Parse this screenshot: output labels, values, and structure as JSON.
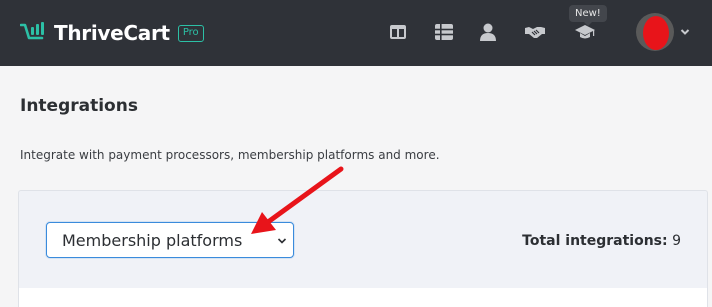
{
  "header": {
    "brand_left": "Thrive",
    "brand_right": "Cart",
    "plan_badge": "Pro",
    "new_tooltip": "New!",
    "icons": [
      "dashboard-icon",
      "list-icon",
      "user-icon",
      "handshake-icon",
      "graduation-cap-icon"
    ],
    "avatar": "user-avatar"
  },
  "page": {
    "title": "Integrations",
    "description": "Integrate with payment processors, membership platforms and more."
  },
  "filter": {
    "selected": "Membership platforms",
    "total_label": "Total integrations:",
    "total_value": "9"
  },
  "colors": {
    "topbar": "#2f3238",
    "brand_accent": "#2cc0a6",
    "annotation_arrow": "#e8141a",
    "select_border": "#3a8bdc"
  }
}
